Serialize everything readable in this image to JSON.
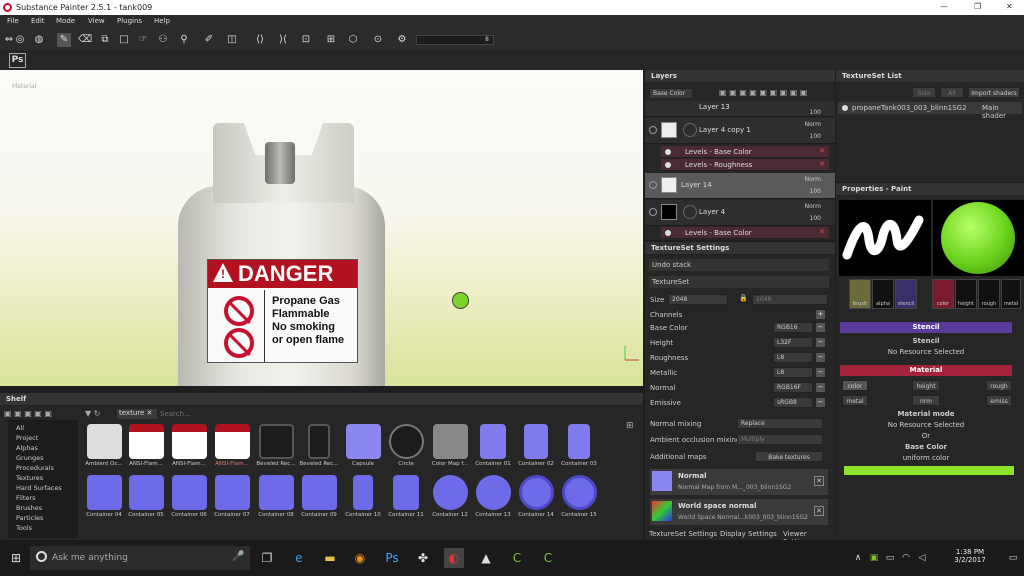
{
  "window": {
    "title": "Substance Painter 2.5.1 - tank009",
    "minimize": "—",
    "maximize": "❐",
    "close": "✕"
  },
  "menu": [
    "File",
    "Edit",
    "Mode",
    "View",
    "Plugins",
    "Help"
  ],
  "toolbar": {
    "ps_label": "Ps",
    "size_value": "8"
  },
  "viewport": {
    "label": "Material",
    "danger": "DANGER",
    "label_lines": [
      "Propane Gas",
      "Flammable",
      "No smoking",
      "or open flame"
    ]
  },
  "layers": {
    "title": "Layers",
    "channel": "Base Color",
    "rows": [
      {
        "name": "Layer 13",
        "blend": "",
        "opacity": "100"
      },
      {
        "name": "Layer 4 copy 1",
        "blend": "Norm",
        "opacity": "100"
      },
      {
        "name": "Layer 14",
        "blend": "Norm",
        "opacity": "100"
      },
      {
        "name": "Layer 4",
        "blend": "Norm",
        "opacity": "100"
      }
    ],
    "effects": [
      "Levels - Base Color",
      "Levels - Roughness",
      "Levels - Base Color"
    ]
  },
  "tss": {
    "title": "TextureSet Settings",
    "undo": "Undo stack",
    "textureset": "TextureSet",
    "size_label": "Size",
    "size_value": "2048",
    "size_value2": "2048",
    "channels_label": "Channels",
    "channels": [
      {
        "name": "Base Color",
        "fmt": "RGB16"
      },
      {
        "name": "Height",
        "fmt": "L32F"
      },
      {
        "name": "Roughness",
        "fmt": "L8"
      },
      {
        "name": "Metallic",
        "fmt": "L8"
      },
      {
        "name": "Normal",
        "fmt": "RGB16F"
      },
      {
        "name": "Emissive",
        "fmt": "sRGB8"
      }
    ],
    "normal_mixing_label": "Normal mixing",
    "normal_mixing": "Replace",
    "ao_mixing_label": "Ambient occlusion mixing",
    "ao_mixing": "Multiply",
    "additional_maps": "Additional maps",
    "bake": "Bake textures",
    "maps": [
      {
        "title": "Normal",
        "sub": "Normal Map from M..._003_blinn1SG2"
      },
      {
        "title": "World space normal",
        "sub": "World Space Normal...k003_003_blinn1SG2"
      }
    ]
  },
  "tabs3": [
    "TextureSet Settings",
    "Display Settings",
    "Viewer Settings"
  ],
  "tsl": {
    "title": "TextureSet List",
    "btn1": "Solo",
    "btn2": "All",
    "btn3": "Import shaders",
    "item": "propaneTank003_003_blinn1SG2",
    "shader": "Main shader"
  },
  "props": {
    "title": "Properties - Paint",
    "channels_left": [
      "brush",
      "alpha",
      "stencil"
    ],
    "channels_right": [
      "color",
      "height",
      "rough",
      "metal"
    ],
    "stencil_header": "Stencil",
    "stencil_title": "Stencil",
    "stencil_value": "No Resource Selected",
    "material_header": "Material",
    "mat_buttons": [
      "color",
      "height",
      "rough",
      "metal",
      "nrm",
      "emiss"
    ],
    "mat_mode": "Material mode",
    "mat_mode_value": "No Resource Selected",
    "or": "Or",
    "base_color": "Base Color",
    "uniform": "uniform color",
    "accent": "#8fe22b"
  },
  "shelf": {
    "title": "Shelf",
    "filter_tag": "texture",
    "search": "Search...",
    "categories": [
      "All",
      "Project",
      "Alphas",
      "Grunges",
      "Procedurals",
      "Textures",
      "Hard Surfaces",
      "Filters",
      "Brushes",
      "Particles",
      "Tools"
    ],
    "row1": [
      "Ambient Oc...",
      "ANSI-Flam...",
      "ANSI-Flam...",
      "ANSI-Flam...",
      "Beveled Rec...",
      "Beveled Rec...",
      "Capsule",
      "Circle",
      "Color Map f...",
      "Container 01",
      "Container 02",
      "Container 03"
    ],
    "row2": [
      "Container 04",
      "Container 05",
      "Container 06",
      "Container 07",
      "Container 08",
      "Container 09",
      "Container 10",
      "Container 11",
      "Container 12",
      "Container 13",
      "Container 14",
      "Container 15"
    ]
  },
  "taskbar": {
    "search": "Ask me anything",
    "time": "1:38 PM",
    "date": "3/2/2017"
  }
}
